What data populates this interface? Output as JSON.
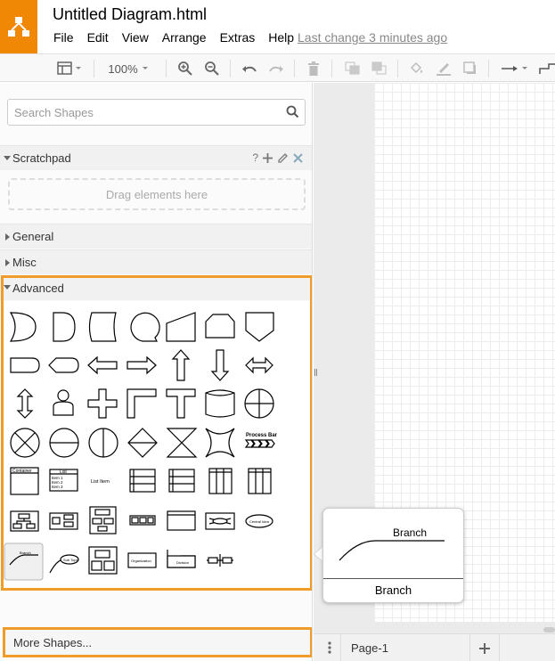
{
  "app": {
    "title": "Untitled Diagram.html",
    "menu": [
      "File",
      "Edit",
      "View",
      "Arrange",
      "Extras",
      "Help"
    ],
    "last_change": "Last change 3 minutes ago",
    "brand_color": "#f08705"
  },
  "toolbar": {
    "zoom": "100%",
    "icons": [
      "format-panel-icon",
      "zoom-in-icon",
      "zoom-out-icon",
      "undo-icon",
      "redo-icon",
      "delete-icon",
      "to-front-icon",
      "to-back-icon",
      "fill-color-icon",
      "line-color-icon",
      "shadow-icon",
      "connection-icon",
      "waypoints-icon"
    ]
  },
  "sidebar": {
    "search_placeholder": "Search Shapes",
    "scratchpad": {
      "label": "Scratchpad",
      "help": "?",
      "dropzone": "Drag elements here"
    },
    "sections": [
      {
        "label": "General",
        "expanded": false
      },
      {
        "label": "Misc",
        "expanded": false
      },
      {
        "label": "Advanced",
        "expanded": true
      }
    ],
    "advanced_shape_labels": {
      "process_bar": "Process Bar",
      "container": "Container",
      "list_title": "List",
      "list_items": [
        "Item 1",
        "Item 2",
        "Item 3"
      ],
      "list_item": "List Item",
      "central_idea": "Central Idea",
      "branch": "Branch",
      "sub_topic": "Sub Topic",
      "organization": "Organization",
      "division": "Division"
    },
    "more_shapes": "More Shapes..."
  },
  "tooltip": {
    "preview_text": "Branch",
    "label": "Branch"
  },
  "bottombar": {
    "page_label": "Page-1"
  },
  "highlight_color": "#f09c2b"
}
